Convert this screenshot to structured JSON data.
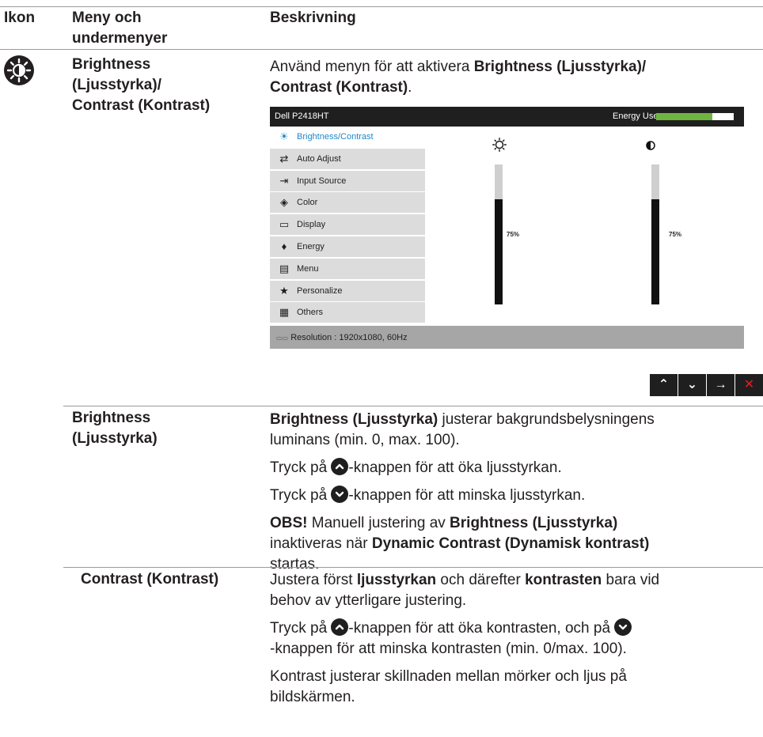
{
  "table_header": {
    "col1": "Ikon",
    "col2": "Meny och undermenyer",
    "col3": "Beskrivning"
  },
  "row_main": {
    "menu_name": "Brightness (Ljusstyrka)/ Contrast (Kontrast)",
    "menu_name_line1": "Brightness",
    "menu_name_line2": "(Ljusstyrka)/",
    "menu_name_line3": "Contrast (Kontrast)",
    "desc_prefix": "Använd menyn för att aktivera ",
    "desc_bold_1": "Brightness (Ljusstyrka)/",
    "desc_bold_2": "Contrast (Kontrast)",
    "desc_suffix": "."
  },
  "osd": {
    "title": "Dell P2418HT",
    "energy_label": "Energy Use",
    "energy_level": 0.72,
    "menu_items": [
      {
        "icon": "brightness-icon",
        "label": "Brightness/Contrast",
        "selected": true
      },
      {
        "icon": "auto-adjust-icon",
        "label": "Auto Adjust"
      },
      {
        "icon": "input-source-icon",
        "label": "Input Source"
      },
      {
        "icon": "color-icon",
        "label": "Color"
      },
      {
        "icon": "display-icon",
        "label": "Display"
      },
      {
        "icon": "energy-icon",
        "label": "Energy"
      },
      {
        "icon": "menu-icon",
        "label": "Menu"
      },
      {
        "icon": "personalize-icon",
        "label": "Personalize"
      },
      {
        "icon": "others-icon",
        "label": "Others"
      }
    ],
    "brightness_value": "75%",
    "brightness_level": 0.75,
    "contrast_value": "75%",
    "contrast_level": 0.75,
    "status_text": "Resolution : 1920x1080, 60Hz"
  },
  "nav_buttons": [
    {
      "icon": "chevron-up-icon",
      "glyph": "⌃"
    },
    {
      "icon": "chevron-down-icon",
      "glyph": "⌄"
    },
    {
      "icon": "arrow-right-icon",
      "glyph": "→"
    },
    {
      "icon": "close-icon",
      "glyph": "✕",
      "color": "#e02020"
    }
  ],
  "row_brightness": {
    "name_line1": "Brightness",
    "name_line2": "(Ljusstyrka)",
    "p1_bold": "Brightness (Ljusstyrka)",
    "p1_rest_line1": " justerar bakgrundsbelysningens",
    "p1_line2": "luminans (min. 0, max. 100).",
    "p2_pre": "Tryck på ",
    "p2_post": "-knappen för att öka ljusstyrkan.",
    "p3_pre": "Tryck på ",
    "p3_post": "-knappen för att minska ljusstyrkan.",
    "note_bold": "OBS!",
    "note_l1": " Manuell justering av ",
    "note_l1_bold": "Brightness (Ljusstyrka)",
    "note_l2": "inaktiveras när ",
    "note_l2_bold": "Dynamic Contrast (Dynamisk kontrast)",
    "note_l3": "startas."
  },
  "row_contrast": {
    "name": "Contrast (Kontrast)",
    "p1_l1_a": "Justera först ",
    "p1_l1_b": "ljusstyrkan",
    "p1_l1_c": " och därefter ",
    "p1_l1_d": "kontrasten",
    "p1_l1_e": " bara vid",
    "p1_l2": "behov av ytterligare justering.",
    "p2_l1_a": "Tryck på ",
    "p2_l1_b": "-knappen för att öka kontrasten, och på ",
    "p2_l2": "-knappen för att minska kontrasten (min. 0/max. 100).",
    "p3_l1": "Kontrast justerar skillnaden mellan mörker och ljus på",
    "p3_l2": "bildskärmen."
  },
  "colors": {
    "text": "#231f20",
    "osd_dark": "#1f1f1f",
    "energy_green": "#6fb43f",
    "highlight_blue": "#1e88c8",
    "close_red": "#e02020"
  }
}
